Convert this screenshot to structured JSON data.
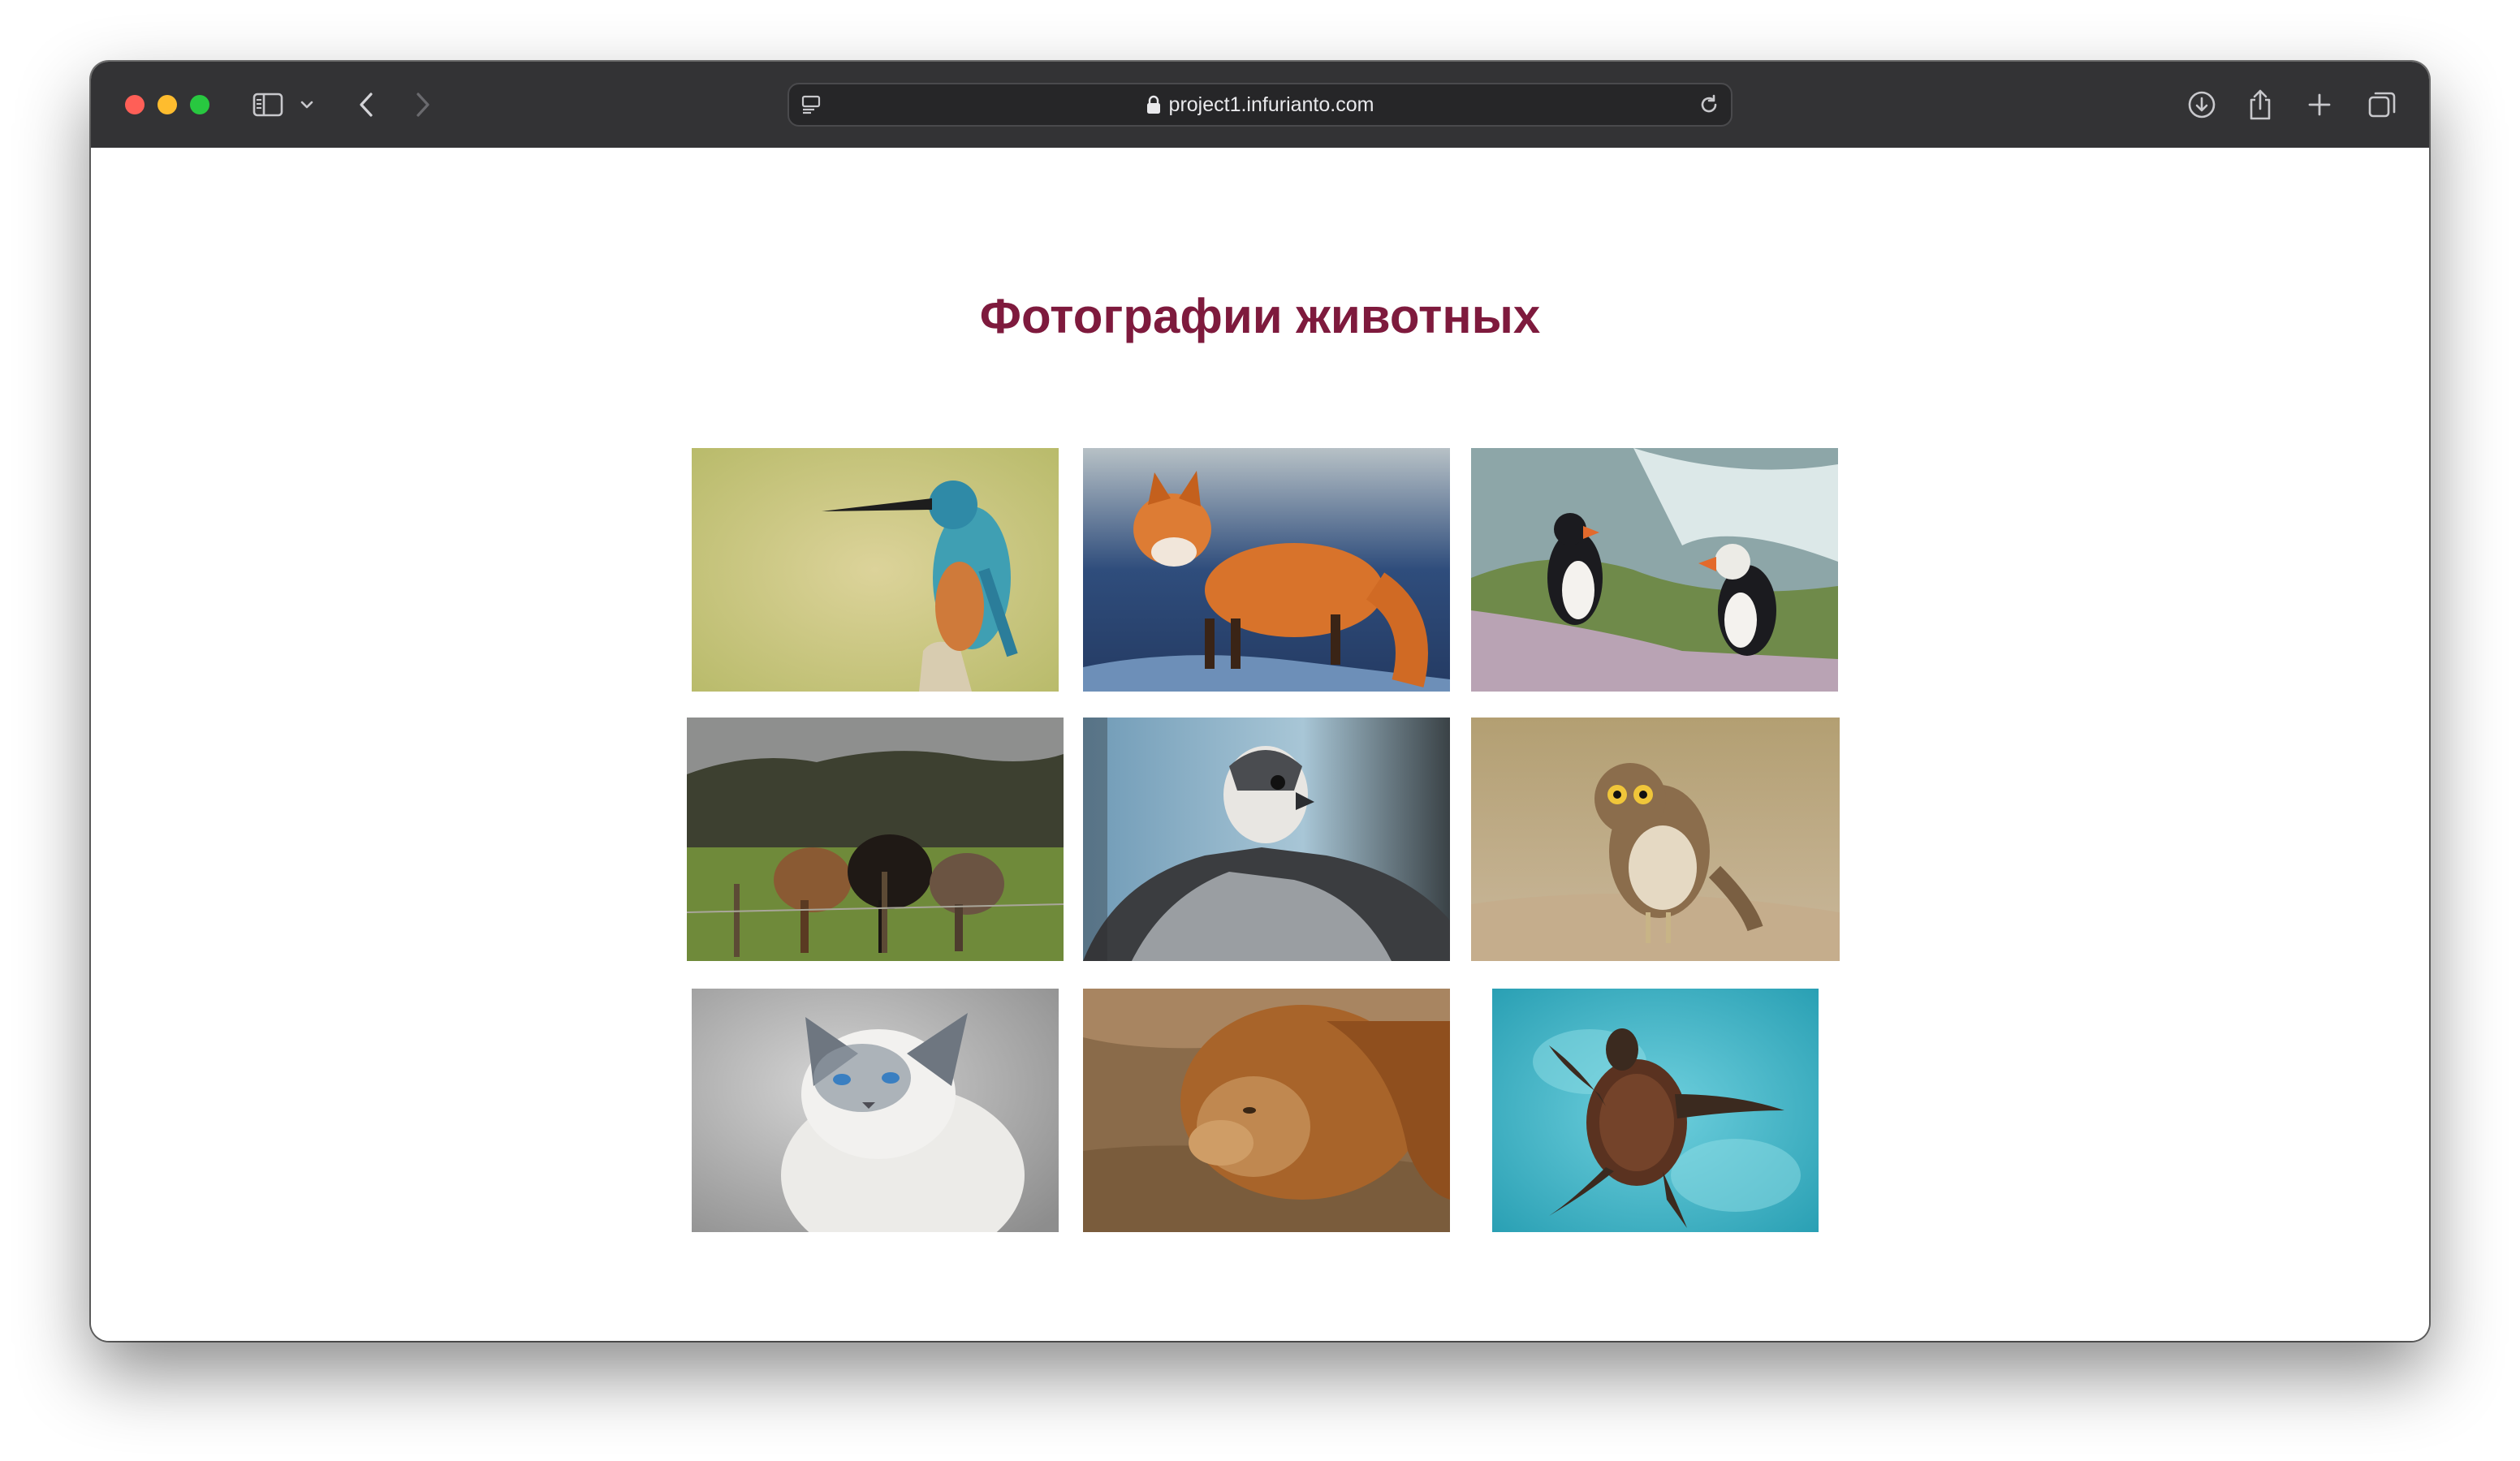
{
  "browser": {
    "url": "project1.infurianto.com",
    "icons": [
      "sidebar-icon",
      "chevron-down-icon",
      "back-icon",
      "forward-icon",
      "page-menu-icon",
      "lock-icon",
      "reload-icon",
      "download-icon",
      "share-icon",
      "new-tab-icon",
      "tabs-overview-icon"
    ]
  },
  "page": {
    "title": "Фотографии животных",
    "title_color": "#7e1a3d",
    "gallery": [
      {
        "subject": "kingfisher"
      },
      {
        "subject": "fox"
      },
      {
        "subject": "puffins"
      },
      {
        "subject": "horses"
      },
      {
        "subject": "falcon"
      },
      {
        "subject": "owl"
      },
      {
        "subject": "cat"
      },
      {
        "subject": "lion"
      },
      {
        "subject": "turtle"
      }
    ]
  }
}
